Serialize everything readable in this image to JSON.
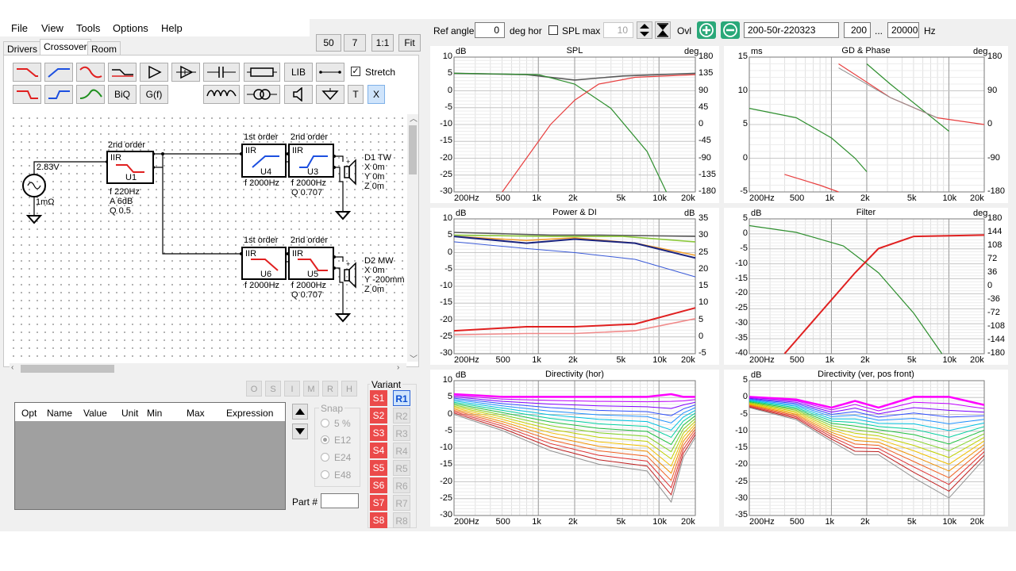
{
  "menu": {
    "items": [
      "File",
      "View",
      "Tools",
      "Options",
      "Help"
    ]
  },
  "zoom_buttons": [
    "50",
    "7",
    "1:1",
    "Fit"
  ],
  "tabs": {
    "drivers": "Drivers",
    "crossover": "Crossover",
    "room": "Room"
  },
  "palette": {
    "biq": "BiQ",
    "gf": "G(f)",
    "lib": "LIB",
    "t": "T",
    "x": "X",
    "stretch_label": "Stretch"
  },
  "schematic": {
    "source": {
      "voltage": "2.83V",
      "impedance": "1mΩ"
    },
    "u1": {
      "order": "2nd order",
      "type": "IIR",
      "name": "U1",
      "f": "f  220Hz",
      "a": "A  6dB",
      "q": "Q  0.5"
    },
    "u4": {
      "order": "1st order",
      "type": "IIR",
      "name": "U4",
      "f": "f  2000Hz"
    },
    "u3": {
      "order": "2nd order",
      "type": "IIR",
      "name": "U3",
      "f": "f  2000Hz",
      "q": "Q  0.707"
    },
    "u6": {
      "order": "1st order",
      "type": "IIR",
      "name": "U6",
      "f": "f  2000Hz"
    },
    "u5": {
      "order": "2nd order",
      "type": "IIR",
      "name": "U5",
      "f": "f  2000Hz",
      "q": "Q  0.707"
    },
    "d1": {
      "name": "D1 TW",
      "x": "X 0m",
      "y": "Y 0m",
      "z": "Z 0m"
    },
    "d2": {
      "name": "D2 MW",
      "x": "X 0m",
      "y": "Y -200mm",
      "z": "Z 0m"
    }
  },
  "optimizer": {
    "buttons": [
      "O",
      "S",
      "I",
      "M",
      "R",
      "H"
    ],
    "columns": [
      "Opt",
      "Name",
      "Value",
      "Unit",
      "Min",
      "Max",
      "Expression"
    ]
  },
  "snap": {
    "title": "Snap",
    "options": [
      "5 %",
      "E12",
      "E24",
      "E48"
    ],
    "selected": "E12"
  },
  "part_label": "Part #",
  "variant": {
    "title": "Variant",
    "s": [
      "S1",
      "S2",
      "S3",
      "S4",
      "S5",
      "S6",
      "S7",
      "S8"
    ],
    "r": [
      "R1",
      "R2",
      "R3",
      "R4",
      "R5",
      "R6",
      "R7",
      "R8"
    ],
    "active_r": "R1"
  },
  "toolbar": {
    "ref_angle_label": "Ref angle",
    "ref_angle_value": "0",
    "deg_hor": "deg hor",
    "spl_max_label": "SPL max",
    "spl_max_value": "10",
    "ovl": "Ovl",
    "project": "200-50r-220323",
    "f_min": "200",
    "dots": "...",
    "f_max": "20000",
    "hz": "Hz"
  },
  "plots": [
    {
      "title": "SPL",
      "left_unit": "dB",
      "right_unit": "deg",
      "left_ticks": [
        "10",
        "5",
        "0",
        "-5",
        "-10",
        "-15",
        "-20",
        "-25",
        "-30"
      ],
      "right_ticks": [
        "180",
        "135",
        "90",
        "45",
        "0",
        "-45",
        "-90",
        "-135",
        "-180"
      ]
    },
    {
      "title": "GD & Phase",
      "left_unit": "ms",
      "right_unit": "deg",
      "left_ticks": [
        "15",
        "10",
        "5",
        "0",
        "-5"
      ],
      "right_ticks": [
        "180",
        "90",
        "0",
        "-90",
        "-180"
      ]
    },
    {
      "title": "Power & DI",
      "left_unit": "dB",
      "right_unit": "dB",
      "left_ticks": [
        "10",
        "5",
        "0",
        "-5",
        "-10",
        "-15",
        "-20",
        "-25",
        "-30"
      ],
      "right_ticks": [
        "35",
        "30",
        "25",
        "20",
        "15",
        "10",
        "5",
        "0",
        "-5"
      ]
    },
    {
      "title": "Filter",
      "left_unit": "dB",
      "right_unit": "deg",
      "left_ticks": [
        "5",
        "0",
        "-5",
        "-10",
        "-15",
        "-20",
        "-25",
        "-30",
        "-35",
        "-40"
      ],
      "right_ticks": [
        "180",
        "144",
        "108",
        "72",
        "36",
        "0",
        "-36",
        "-72",
        "-108",
        "-144",
        "-180"
      ]
    },
    {
      "title": "Directivity (hor)",
      "left_unit": "dB",
      "right_unit": "",
      "left_ticks": [
        "10",
        "5",
        "0",
        "-5",
        "-10",
        "-15",
        "-20",
        "-25",
        "-30"
      ],
      "right_ticks": []
    },
    {
      "title": "Directivity (ver, pos front)",
      "left_unit": "dB",
      "right_unit": "",
      "left_ticks": [
        "5",
        "0",
        "-5",
        "-10",
        "-15",
        "-20",
        "-25",
        "-30",
        "-35"
      ],
      "right_ticks": []
    }
  ],
  "x_ticks": [
    "200Hz",
    "500",
    "1k",
    "2k",
    "5k",
    "10k",
    "20k"
  ]
}
